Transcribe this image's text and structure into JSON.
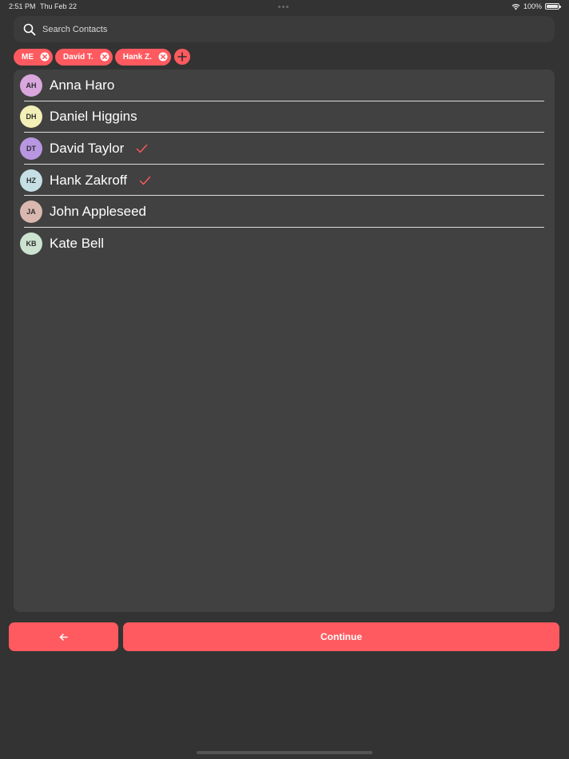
{
  "status_bar": {
    "time": "2:51 PM",
    "date": "Thu Feb 22",
    "battery": "100%",
    "wifi_icon": "wifi-icon",
    "battery_icon": "battery-icon"
  },
  "search": {
    "placeholder": "Search Contacts",
    "value": "",
    "icon": "search-icon"
  },
  "selected_chips": [
    {
      "label": "ME"
    },
    {
      "label": "David T."
    },
    {
      "label": "Hank Z."
    }
  ],
  "contacts": [
    {
      "initials": "AH",
      "name": "Anna Haro",
      "avatar_color": "#d9a6dd",
      "selected": false
    },
    {
      "initials": "DH",
      "name": "Daniel Higgins",
      "avatar_color": "#f2f0b6",
      "selected": false
    },
    {
      "initials": "DT",
      "name": "David Taylor",
      "avatar_color": "#b896e2",
      "selected": true
    },
    {
      "initials": "HZ",
      "name": "Hank Zakroff",
      "avatar_color": "#c5dfe4",
      "selected": true
    },
    {
      "initials": "JA",
      "name": "John Appleseed",
      "avatar_color": "#dab8b0",
      "selected": false
    },
    {
      "initials": "KB",
      "name": "Kate Bell",
      "avatar_color": "#cce3d0",
      "selected": false
    }
  ],
  "buttons": {
    "back_icon": "arrow-left-icon",
    "continue_label": "Continue"
  },
  "colors": {
    "accent": "#ff5a5f",
    "background": "#333333",
    "list_background": "#414141"
  }
}
